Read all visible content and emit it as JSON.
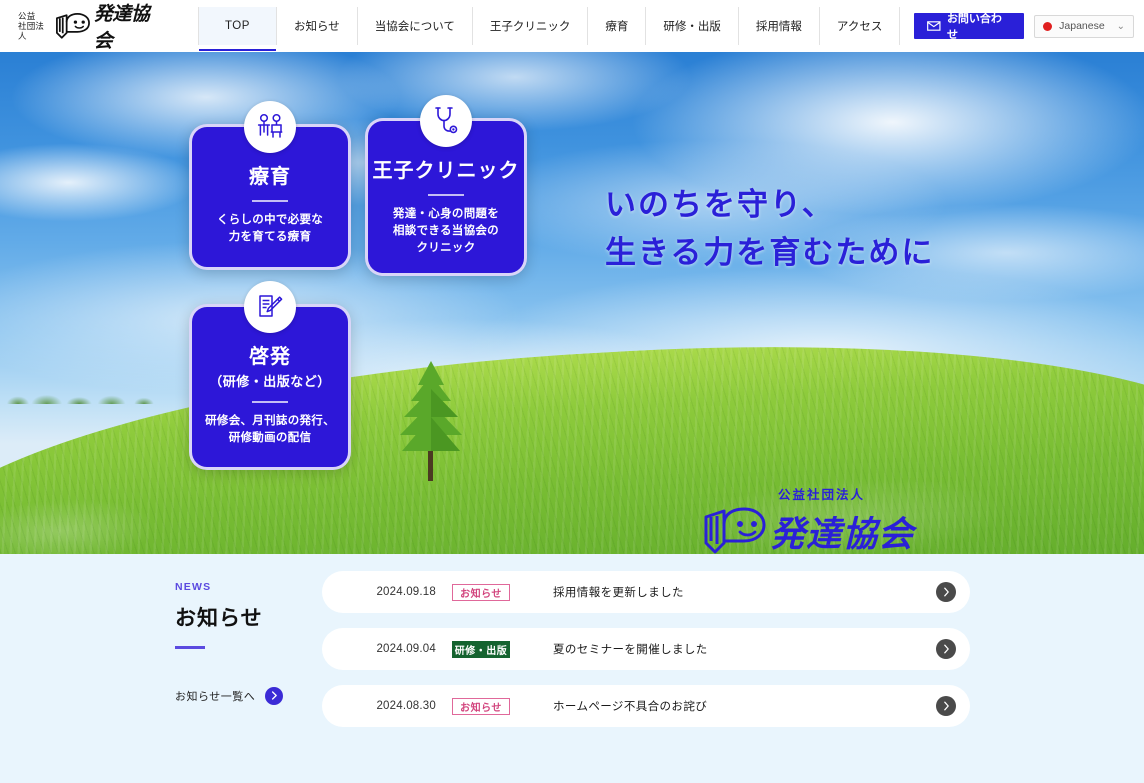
{
  "header": {
    "brand": {
      "pre_line1": "公益",
      "pre_line2": "社団法人",
      "name": "発達協会",
      "logo_icon": "person-hand-logo-icon"
    },
    "nav_items": [
      {
        "label": "TOP",
        "active": true
      },
      {
        "label": "お知らせ",
        "active": false
      },
      {
        "label": "当協会について",
        "active": false
      },
      {
        "label": "王子クリニック",
        "active": false
      },
      {
        "label": "療育",
        "active": false
      },
      {
        "label": "研修・出版",
        "active": false
      },
      {
        "label": "採用情報",
        "active": false
      },
      {
        "label": "アクセス",
        "active": false
      }
    ],
    "contact_button": {
      "label": "お問い合わせ",
      "icon": "envelope-icon"
    },
    "language_select": {
      "value": "Japanese",
      "flag": "japan-flag-dot",
      "chevron": "⌄"
    }
  },
  "hero": {
    "copy_line1": "いのちを守り、",
    "copy_line2": "生きる力を育むために",
    "watermark": {
      "pre": "公益社団法人",
      "name": "発達協会",
      "icon": "person-hand-logo-icon"
    },
    "cards": [
      {
        "id": "ryoiku",
        "icon": "two-children-icon",
        "title": "療育",
        "paren": "",
        "desc_line1": "くらしの中で必要な",
        "desc_line2": "力を育てる療育",
        "desc_line3": ""
      },
      {
        "id": "clinic",
        "icon": "stethoscope-icon",
        "title": "王子クリニック",
        "paren": "",
        "desc_line1": "発達・心身の問題を",
        "desc_line2": "相談できる当協会の",
        "desc_line3": "クリニック"
      },
      {
        "id": "keihatsu",
        "icon": "document-pencil-icon",
        "title": "啓発",
        "paren": "（研修・出版など）",
        "desc_line1": "研修会、月刊誌の発行、",
        "desc_line2": "研修動画の配信",
        "desc_line3": ""
      }
    ]
  },
  "news": {
    "eyebrow": "NEWS",
    "heading": "お知らせ",
    "more_label": "お知らせ一覧へ",
    "more_icon": "chevron-right-icon",
    "items": [
      {
        "date": "2024.09.18",
        "tag": "お知らせ",
        "tag_type": "info",
        "title": "採用情報を更新しました",
        "arrow_icon": "chevron-right-icon"
      },
      {
        "date": "2024.09.04",
        "tag": "研修・出版",
        "tag_type": "training",
        "title": "夏のセミナーを開催しました",
        "arrow_icon": "chevron-right-icon"
      },
      {
        "date": "2024.08.30",
        "tag": "お知らせ",
        "tag_type": "info",
        "title": "ホームページ不具合のお詫び",
        "arrow_icon": "chevron-right-icon"
      }
    ]
  },
  "colors": {
    "brand_blue": "#2a20d8",
    "card_blue": "#2d17d8",
    "news_bg": "#e9f5fd",
    "tag_info_border": "#e0689a",
    "tag_info_text": "#d2457e",
    "tag_training_bg": "#14632f",
    "flag_red": "#e02020"
  }
}
